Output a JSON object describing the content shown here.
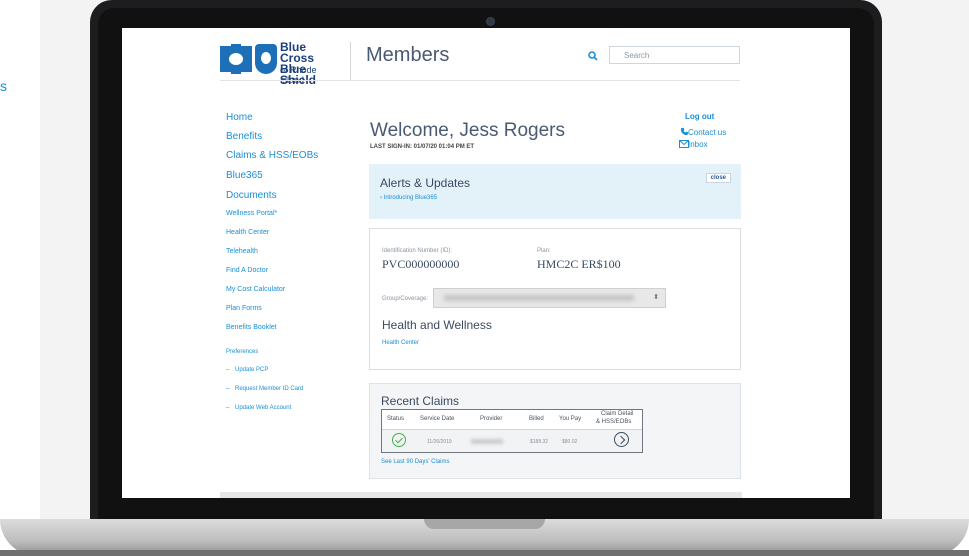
{
  "edge_text": "s",
  "header": {
    "logo_line1": "Blue Cross",
    "logo_line2": "Blue Shield",
    "logo_line3": "of Rhode Island",
    "section_title": "Members",
    "search_placeholder": "Search"
  },
  "nav": {
    "primary": [
      "Home",
      "Benefits",
      "Claims & HSS/EOBs",
      "Blue365",
      "Documents"
    ],
    "secondary": [
      "Wellness Portal*",
      "Health Center",
      "Telehealth",
      "Find A Doctor",
      "My Cost Calculator",
      "Plan Forms",
      "Benefits Booklet"
    ],
    "preferences_label": "Preferences",
    "preferences": [
      "Update PCP",
      "Request Member ID Card",
      "Update Web Account"
    ]
  },
  "account": {
    "welcome": "Welcome, Jess Rogers",
    "last_signin": "LAST SIGN-IN: 01/07/20 01:04 PM ET",
    "logout": "Log out",
    "contact": "Contact us",
    "inbox": "Inbox"
  },
  "alerts": {
    "title": "Alerts & Updates",
    "link": "› Introducing Blue365",
    "close": "close"
  },
  "member_card": {
    "id_label": "Identification Number (ID):",
    "id_value": "PVC000000000",
    "plan_label": "Plan:",
    "plan_value": "HMC2C ER$100",
    "group_label": "Group/Coverage:",
    "health_title": "Health and Wellness",
    "health_link": "Health Center"
  },
  "claims": {
    "title": "Recent Claims",
    "headers": [
      "Status",
      "Service Date",
      "Provider",
      "Billed",
      "You Pay",
      "Claim Detail",
      "& HSS/EOBs"
    ],
    "row": {
      "date": "11/26/2019",
      "billed": "$188.32",
      "you_pay": "$80.02"
    },
    "link": "See Last 90 Days' Claims"
  },
  "colors": {
    "accent": "#1a8fd6",
    "text": "#4a5a72",
    "alert_bg": "#e3f1f8",
    "brand": "#1d6fb8"
  }
}
